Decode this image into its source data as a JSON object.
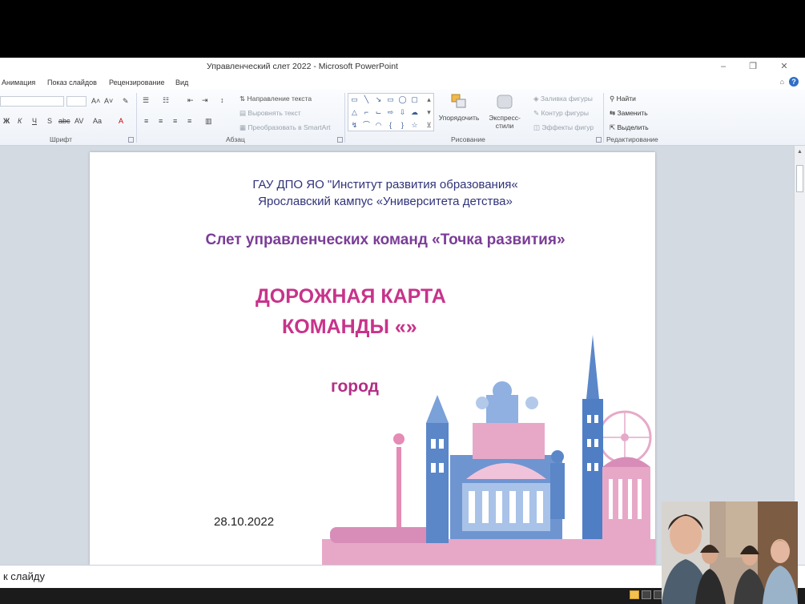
{
  "window": {
    "title": "Управленческий слет 2022 - Microsoft PowerPoint",
    "minimize_glyph": "–",
    "restore_glyph": "❐",
    "close_glyph": "✕"
  },
  "tabs": [
    "Анимация",
    "Показ слайдов",
    "Рецензирование",
    "Вид"
  ],
  "ribbon": {
    "groups": {
      "font": "Шрифт",
      "paragraph": "Абзац",
      "drawing": "Рисование",
      "editing": "Редактирование"
    },
    "paragraph": {
      "text_direction": "Направление текста",
      "align_text": "Выровнять текст",
      "convert_smartart": "Преобразовать в SmartArt"
    },
    "drawing": {
      "arrange": "Упорядочить",
      "quick_styles": "Экспресс-стили",
      "shape_fill": "Заливка фигуры",
      "shape_outline": "Контур фигуры",
      "shape_effects": "Эффекты фигур"
    },
    "editing": {
      "find": "Найти",
      "replace": "Заменить",
      "select": "Выделить"
    },
    "font_buttons": [
      "Ж",
      "К",
      "Ч",
      "S",
      "abc",
      "AV",
      "Aa",
      "A"
    ]
  },
  "slide": {
    "org_line1": "ГАУ ДПО ЯО \"Институт развития образования«",
    "org_line2": "Ярославский кампус «Университета детства»",
    "event": "Слет управленческих команд «Точка развития»",
    "title_line1": "ДОРОЖНАЯ КАРТА",
    "title_line2": "КОМАНДЫ «»",
    "city": "город",
    "date": "28.10.2022"
  },
  "notes": {
    "text": "к слайду"
  },
  "colors": {
    "accent_pink": "#c8338a",
    "accent_purple": "#7a3d97",
    "org_navy": "#30337a"
  }
}
